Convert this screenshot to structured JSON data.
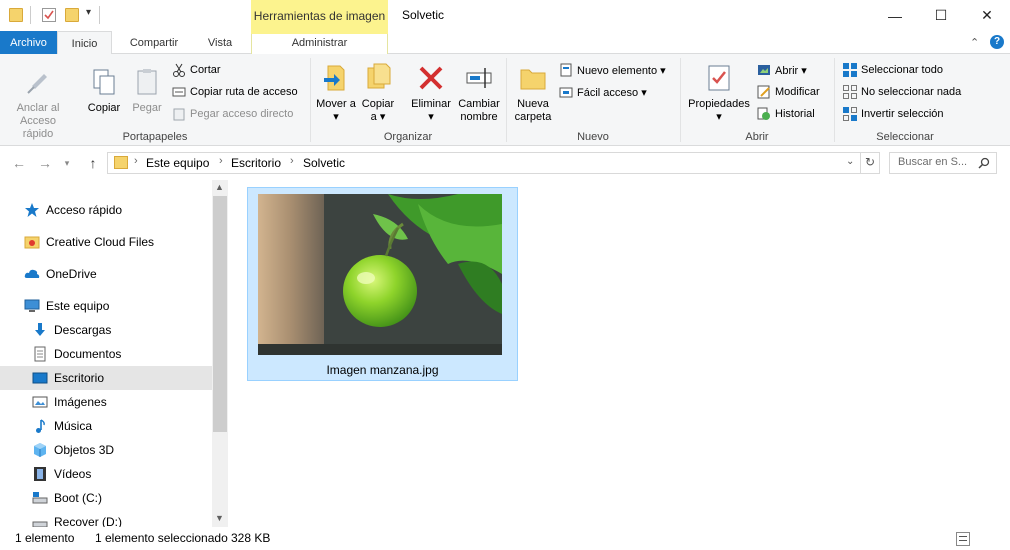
{
  "window": {
    "title": "Solvetic",
    "contextual_tab_header": "Herramientas de imagen",
    "minimize": "—",
    "maximize": "☐",
    "close": "✕"
  },
  "tabs": {
    "archivo": "Archivo",
    "inicio": "Inicio",
    "compartir": "Compartir",
    "vista": "Vista",
    "administrar": "Administrar"
  },
  "ribbon": {
    "portapapeles": {
      "label": "Portapapeles",
      "anclar": "Anclar al Acceso rápido",
      "copiar": "Copiar",
      "pegar": "Pegar",
      "cortar": "Cortar",
      "copiar_ruta": "Copiar ruta de acceso",
      "pegar_acceso": "Pegar acceso directo"
    },
    "organizar": {
      "label": "Organizar",
      "mover": "Mover a ▾",
      "copiar": "Copiar a ▾",
      "eliminar": "Eliminar ▾",
      "cambiar": "Cambiar nombre"
    },
    "nuevo": {
      "label": "Nuevo",
      "nueva_carpeta": "Nueva carpeta",
      "nuevo_elemento": "Nuevo elemento ▾",
      "facil_acceso": "Fácil acceso ▾"
    },
    "abrir": {
      "label": "Abrir",
      "propiedades": "Propiedades ▾",
      "abrir": "Abrir ▾",
      "modificar": "Modificar",
      "historial": "Historial"
    },
    "seleccionar": {
      "label": "Seleccionar",
      "todo": "Seleccionar todo",
      "nada": "No seleccionar nada",
      "invertir": "Invertir selección"
    }
  },
  "address": {
    "crumbs": [
      "Este equipo",
      "Escritorio",
      "Solvetic"
    ],
    "search_placeholder": "Buscar en S..."
  },
  "navpane": {
    "items": [
      {
        "label": "Acceso rápido"
      },
      {
        "label": "Creative Cloud Files"
      },
      {
        "label": "OneDrive"
      },
      {
        "label": "Este equipo"
      },
      {
        "label": "Descargas"
      },
      {
        "label": "Documentos"
      },
      {
        "label": "Escritorio"
      },
      {
        "label": "Imágenes"
      },
      {
        "label": "Música"
      },
      {
        "label": "Objetos 3D"
      },
      {
        "label": "Vídeos"
      },
      {
        "label": "Boot (C:)"
      },
      {
        "label": "Recover (D:)"
      }
    ]
  },
  "content": {
    "file_name": "Imagen manzana.jpg"
  },
  "status": {
    "count": "1 elemento",
    "selected": "1 elemento seleccionado",
    "size": "328 KB"
  },
  "colors": {
    "accent": "#1979ca",
    "contextual": "#fcf38e",
    "selection": "#cce8ff"
  }
}
